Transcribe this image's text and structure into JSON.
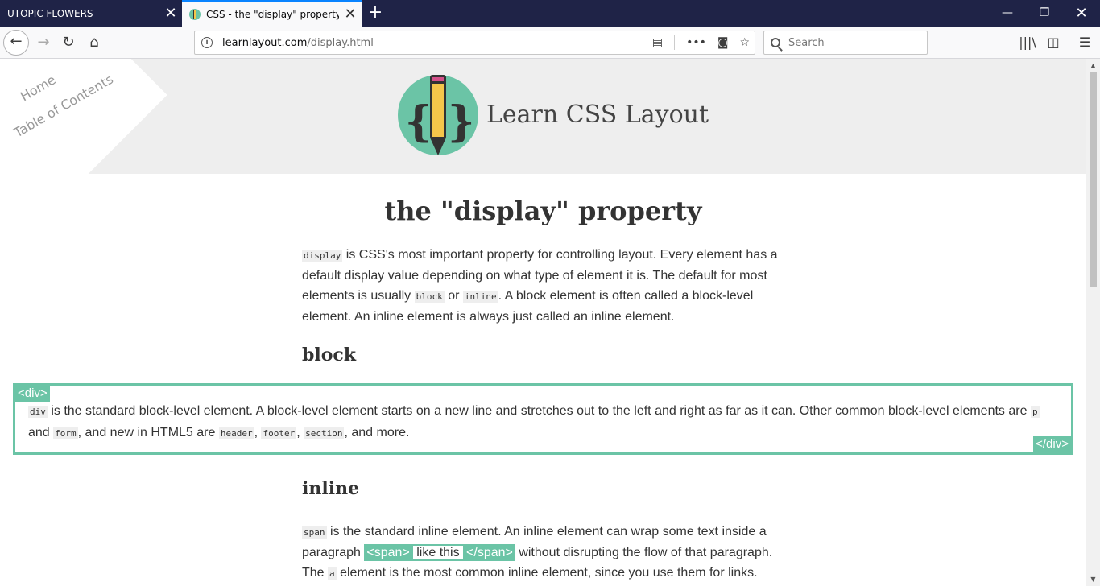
{
  "browser": {
    "tabs": [
      {
        "title": "UTOPIC FLOWERS"
      },
      {
        "title": "CSS - the \"display\" property"
      }
    ],
    "url_host": "learnlayout.com",
    "url_path": "/display.html",
    "search_placeholder": "Search"
  },
  "site": {
    "corner_home": "Home",
    "corner_toc": "Table of Contents",
    "brand": "Learn CSS Layout"
  },
  "content": {
    "title": "the \"display\" property",
    "intro": {
      "code1": "display",
      "t1": " is CSS's most important property for controlling layout. Every element has a default display value depending on what type of element it is. The default for most elements is usually ",
      "code2": "block",
      "t2": " or ",
      "code3": "inline",
      "t3": ". A block element is often called a block-level element. An inline element is always just called an inline element."
    },
    "block_heading": "block",
    "div_open": "<div>",
    "div_close": "</div>",
    "block_para": {
      "code1": "div",
      "t1": " is the standard block-level element. A block-level element starts on a new line and stretches out to the left and right as far as it can. Other common block-level elements are ",
      "code2": "p",
      "t2": " and ",
      "code3": "form",
      "t3": ", and new in HTML5 are ",
      "code4": "header",
      "t4": ", ",
      "code5": "footer",
      "t5": ", ",
      "code6": "section",
      "t6": ", and more."
    },
    "inline_heading": "inline",
    "inline_para": {
      "code1": "span",
      "t1": " is the standard inline element. An inline element can wrap some text inside a paragraph ",
      "span_open": "<span>",
      "span_text": "like this",
      "span_close": "</span>",
      "t2": " without disrupting the flow of that paragraph. The ",
      "code2": "a",
      "t3": " element is the most common inline element, since you use them for links."
    }
  }
}
